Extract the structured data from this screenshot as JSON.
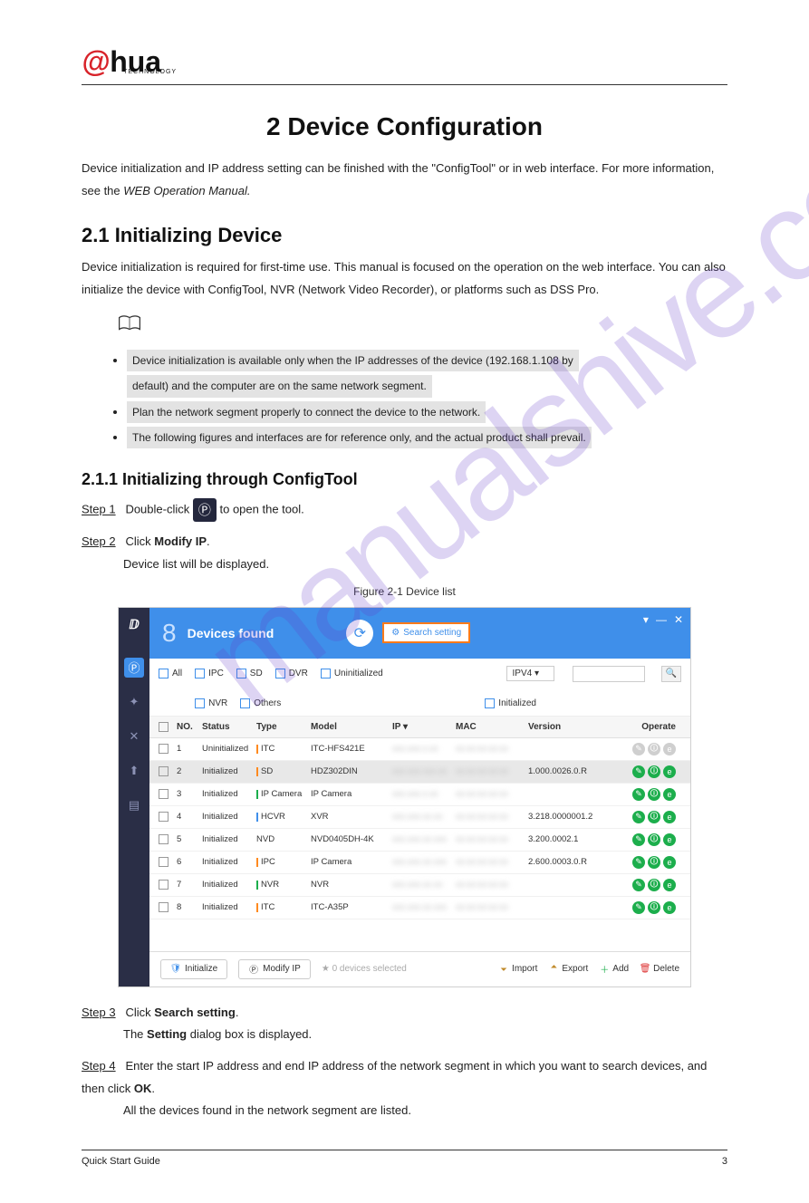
{
  "logo": {
    "part1": "@",
    "part2": "hua",
    "sub": "TECHNOLOGY"
  },
  "watermark": "manualshive.com",
  "chapter_title": "2 Device Configuration",
  "intro_para": "Device initialization and IP address setting can be finished with the \"ConfigTool\" or in web interface. For more information, see the",
  "intro_link": "WEB Operation Manual.",
  "sec21": "2.1 Initializing Device",
  "sec21_body": "Device initialization is required for first-time use. This manual is focused on the operation on the web interface. You can also initialize the device with ConfigTool, NVR (Network Video Recorder), or platforms such as DSS Pro.",
  "notes": [
    "Device initialization is available only when the IP addresses of the device (192.168.1.108 by",
    "default) and the computer are on the same network segment.",
    "Plan the network segment properly to connect the device to the network.",
    "The following figures and interfaces are for reference only, and the actual product shall prevail."
  ],
  "sec211": "2.1.1 Initializing through ConfigTool",
  "step1_label": "Step 1",
  "step1_body_pre": "Double-click",
  "step1_body_post": "to open the tool.",
  "step2_label": "Step 2",
  "step2_body_pre": "Click",
  "step2_link": "Modify IP",
  "step2_body_post": ".",
  "step2_body2": "Device list will be displayed.",
  "figure_label": "Figure 2-1 Device list",
  "app": {
    "count": "8",
    "devices_found": "Devices found",
    "search_setting": "Search setting",
    "win": {
      "help": "▾",
      "min": "—",
      "close": "✕"
    },
    "filters": {
      "all": "All",
      "ipc": "IPC",
      "sd": "SD",
      "dvr": "DVR",
      "nvr": "NVR",
      "others": "Others",
      "uninit": "Uninitialized",
      "init": "Initialized",
      "ipv": "IPV4"
    },
    "headers": {
      "no": "NO.",
      "status": "Status",
      "type": "Type",
      "model": "Model",
      "ip": "IP",
      "mac": "MAC",
      "version": "Version",
      "operate": "Operate"
    },
    "rows": [
      {
        "no": "1",
        "status": "Uninitialized",
        "type": "ITC",
        "type_color": "#ff8a1f",
        "model": "ITC-HFS421E",
        "ip": "xxx.xxx.x.xx",
        "mac": "xx:xx:xx:xx:xx",
        "version": "",
        "op_gray": true
      },
      {
        "no": "2",
        "status": "Initialized",
        "type": "SD",
        "type_color": "#ff8a1f",
        "model": "HDZ302DIN",
        "ip": "xxx.xxx.xxx.xx",
        "mac": "xx:xx:xx:xx:xx",
        "version": "1.000.0026.0.R",
        "selected": true
      },
      {
        "no": "3",
        "status": "Initialized",
        "type": "IP Camera",
        "type_color": "#1cae4c",
        "model": "IP Camera",
        "ip": "xxx.xxx.x.xx",
        "mac": "xx:xx:xx:xx:xx",
        "version": ""
      },
      {
        "no": "4",
        "status": "Initialized",
        "type": "HCVR",
        "type_color": "#3f8fea",
        "model": "XVR",
        "ip": "xxx.xxx.xx.xx",
        "mac": "xx:xx:xx:xx:xx",
        "version": "3.218.0000001.2"
      },
      {
        "no": "5",
        "status": "Initialized",
        "type": "NVD",
        "type_color": "",
        "model": "NVD0405DH-4K",
        "ip": "xxx.xxx.xx.xxx",
        "mac": "xx:xx:xx:xx:xx",
        "version": "3.200.0002.1"
      },
      {
        "no": "6",
        "status": "Initialized",
        "type": "IPC",
        "type_color": "#ff8a1f",
        "model": "IP Camera",
        "ip": "xxx.xxx.xx.xxx",
        "mac": "xx:xx:xx:xx:xx",
        "version": "2.600.0003.0.R"
      },
      {
        "no": "7",
        "status": "Initialized",
        "type": "NVR",
        "type_color": "#1cae4c",
        "model": "NVR",
        "ip": "xxx.xxx.xx.xx",
        "mac": "xx:xx:xx:xx:xx",
        "version": ""
      },
      {
        "no": "8",
        "status": "Initialized",
        "type": "ITC",
        "type_color": "#ff8a1f",
        "model": "ITC-A35P",
        "ip": "xxx.xxx.xx.xxx",
        "mac": "xx:xx:xx:xx:xx",
        "version": ""
      }
    ],
    "bottom": {
      "initialize": "Initialize",
      "modify_ip": "Modify IP",
      "selected": "0  devices selected",
      "import": "Import",
      "export": "Export",
      "add": "Add",
      "delete": "Delete"
    }
  },
  "step3_label": "Step 3",
  "step3_body_pre": "Click",
  "step3_link": "Search setting",
  "step3_body_post": ".",
  "step3_body_pre2": "The",
  "step3_link2": "Setting",
  "step3_body_post2": "dialog box is displayed.",
  "step4_label": "Step 4",
  "step4_body_pre": "Enter the start IP address and end IP address of the network segment in which you want to search devices, and then click",
  "step4_link": "OK",
  "step4_body_post": ".",
  "step4_body2": "All the devices found in the network segment are listed.",
  "footer": {
    "left": "Quick Start Guide",
    "right": "3"
  }
}
